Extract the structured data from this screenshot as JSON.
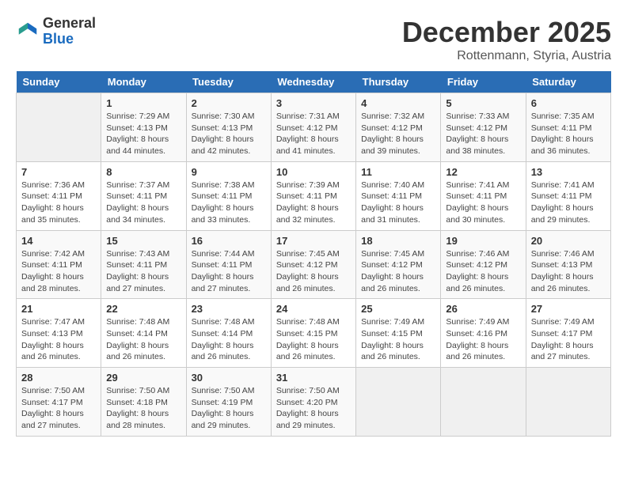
{
  "header": {
    "logo_general": "General",
    "logo_blue": "Blue",
    "month_year": "December 2025",
    "location": "Rottenmann, Styria, Austria"
  },
  "weekdays": [
    "Sunday",
    "Monday",
    "Tuesday",
    "Wednesday",
    "Thursday",
    "Friday",
    "Saturday"
  ],
  "weeks": [
    [
      {
        "day": "",
        "info": ""
      },
      {
        "day": "1",
        "info": "Sunrise: 7:29 AM\nSunset: 4:13 PM\nDaylight: 8 hours\nand 44 minutes."
      },
      {
        "day": "2",
        "info": "Sunrise: 7:30 AM\nSunset: 4:13 PM\nDaylight: 8 hours\nand 42 minutes."
      },
      {
        "day": "3",
        "info": "Sunrise: 7:31 AM\nSunset: 4:12 PM\nDaylight: 8 hours\nand 41 minutes."
      },
      {
        "day": "4",
        "info": "Sunrise: 7:32 AM\nSunset: 4:12 PM\nDaylight: 8 hours\nand 39 minutes."
      },
      {
        "day": "5",
        "info": "Sunrise: 7:33 AM\nSunset: 4:12 PM\nDaylight: 8 hours\nand 38 minutes."
      },
      {
        "day": "6",
        "info": "Sunrise: 7:35 AM\nSunset: 4:11 PM\nDaylight: 8 hours\nand 36 minutes."
      }
    ],
    [
      {
        "day": "7",
        "info": "Sunrise: 7:36 AM\nSunset: 4:11 PM\nDaylight: 8 hours\nand 35 minutes."
      },
      {
        "day": "8",
        "info": "Sunrise: 7:37 AM\nSunset: 4:11 PM\nDaylight: 8 hours\nand 34 minutes."
      },
      {
        "day": "9",
        "info": "Sunrise: 7:38 AM\nSunset: 4:11 PM\nDaylight: 8 hours\nand 33 minutes."
      },
      {
        "day": "10",
        "info": "Sunrise: 7:39 AM\nSunset: 4:11 PM\nDaylight: 8 hours\nand 32 minutes."
      },
      {
        "day": "11",
        "info": "Sunrise: 7:40 AM\nSunset: 4:11 PM\nDaylight: 8 hours\nand 31 minutes."
      },
      {
        "day": "12",
        "info": "Sunrise: 7:41 AM\nSunset: 4:11 PM\nDaylight: 8 hours\nand 30 minutes."
      },
      {
        "day": "13",
        "info": "Sunrise: 7:41 AM\nSunset: 4:11 PM\nDaylight: 8 hours\nand 29 minutes."
      }
    ],
    [
      {
        "day": "14",
        "info": "Sunrise: 7:42 AM\nSunset: 4:11 PM\nDaylight: 8 hours\nand 28 minutes."
      },
      {
        "day": "15",
        "info": "Sunrise: 7:43 AM\nSunset: 4:11 PM\nDaylight: 8 hours\nand 27 minutes."
      },
      {
        "day": "16",
        "info": "Sunrise: 7:44 AM\nSunset: 4:11 PM\nDaylight: 8 hours\nand 27 minutes."
      },
      {
        "day": "17",
        "info": "Sunrise: 7:45 AM\nSunset: 4:12 PM\nDaylight: 8 hours\nand 26 minutes."
      },
      {
        "day": "18",
        "info": "Sunrise: 7:45 AM\nSunset: 4:12 PM\nDaylight: 8 hours\nand 26 minutes."
      },
      {
        "day": "19",
        "info": "Sunrise: 7:46 AM\nSunset: 4:12 PM\nDaylight: 8 hours\nand 26 minutes."
      },
      {
        "day": "20",
        "info": "Sunrise: 7:46 AM\nSunset: 4:13 PM\nDaylight: 8 hours\nand 26 minutes."
      }
    ],
    [
      {
        "day": "21",
        "info": "Sunrise: 7:47 AM\nSunset: 4:13 PM\nDaylight: 8 hours\nand 26 minutes."
      },
      {
        "day": "22",
        "info": "Sunrise: 7:48 AM\nSunset: 4:14 PM\nDaylight: 8 hours\nand 26 minutes."
      },
      {
        "day": "23",
        "info": "Sunrise: 7:48 AM\nSunset: 4:14 PM\nDaylight: 8 hours\nand 26 minutes."
      },
      {
        "day": "24",
        "info": "Sunrise: 7:48 AM\nSunset: 4:15 PM\nDaylight: 8 hours\nand 26 minutes."
      },
      {
        "day": "25",
        "info": "Sunrise: 7:49 AM\nSunset: 4:15 PM\nDaylight: 8 hours\nand 26 minutes."
      },
      {
        "day": "26",
        "info": "Sunrise: 7:49 AM\nSunset: 4:16 PM\nDaylight: 8 hours\nand 26 minutes."
      },
      {
        "day": "27",
        "info": "Sunrise: 7:49 AM\nSunset: 4:17 PM\nDaylight: 8 hours\nand 27 minutes."
      }
    ],
    [
      {
        "day": "28",
        "info": "Sunrise: 7:50 AM\nSunset: 4:17 PM\nDaylight: 8 hours\nand 27 minutes."
      },
      {
        "day": "29",
        "info": "Sunrise: 7:50 AM\nSunset: 4:18 PM\nDaylight: 8 hours\nand 28 minutes."
      },
      {
        "day": "30",
        "info": "Sunrise: 7:50 AM\nSunset: 4:19 PM\nDaylight: 8 hours\nand 29 minutes."
      },
      {
        "day": "31",
        "info": "Sunrise: 7:50 AM\nSunset: 4:20 PM\nDaylight: 8 hours\nand 29 minutes."
      },
      {
        "day": "",
        "info": ""
      },
      {
        "day": "",
        "info": ""
      },
      {
        "day": "",
        "info": ""
      }
    ]
  ]
}
